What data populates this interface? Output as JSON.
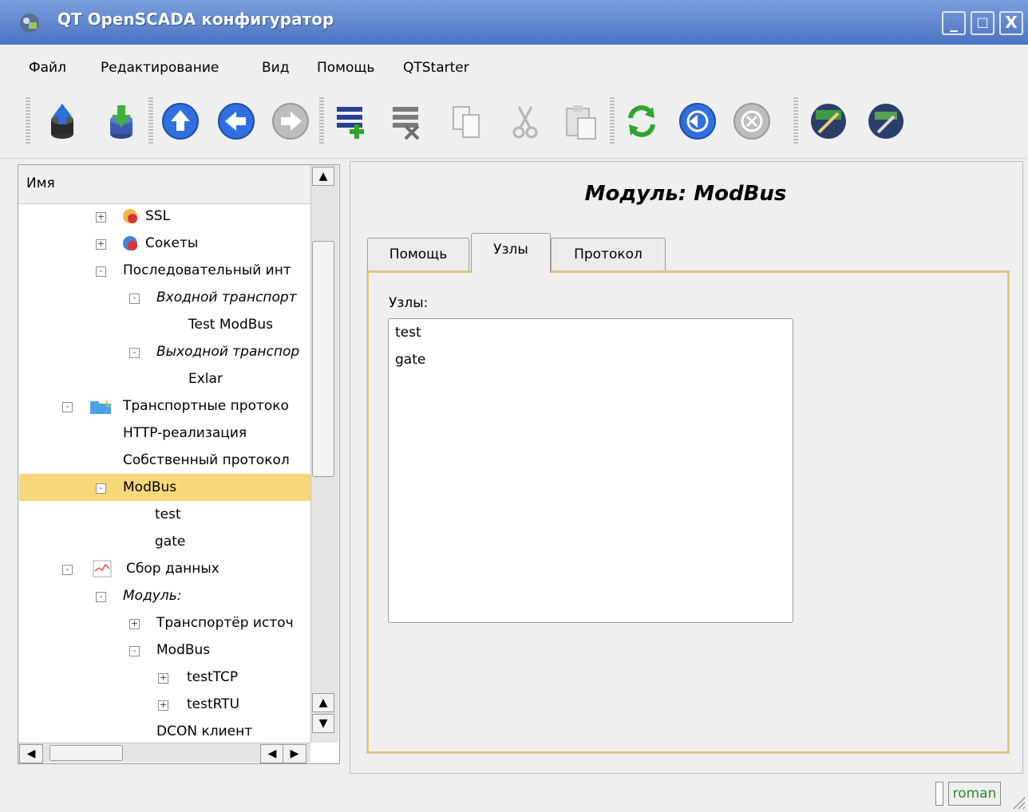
{
  "window": {
    "title": "QT OpenSCADA конфигуратор",
    "controls": {
      "minimize": "_",
      "maximize": "□",
      "close": "X"
    }
  },
  "menu": {
    "items": [
      {
        "label": "Файл"
      },
      {
        "label": "Редактирование"
      },
      {
        "label": "Вид"
      },
      {
        "label": "Помощь"
      },
      {
        "label": "QTStarter"
      }
    ]
  },
  "toolbar": {
    "buttons": [
      {
        "icon": "db-upload-icon"
      },
      {
        "icon": "db-download-icon"
      },
      {
        "icon": "arrow-up-icon"
      },
      {
        "icon": "arrow-back-icon"
      },
      {
        "icon": "arrow-forward-icon"
      },
      {
        "icon": "add-item-icon"
      },
      {
        "icon": "delete-item-icon"
      },
      {
        "icon": "copy-icon"
      },
      {
        "icon": "cut-icon"
      },
      {
        "icon": "paste-icon"
      },
      {
        "icon": "refresh-icon"
      },
      {
        "icon": "start-icon"
      },
      {
        "icon": "stop-icon"
      },
      {
        "icon": "qt-configurator-icon"
      },
      {
        "icon": "qt-starter-icon"
      }
    ]
  },
  "tree": {
    "header": "Имя",
    "rows": [
      {
        "label": "SSL",
        "expander": "+",
        "italic": false
      },
      {
        "label": "Сокеты",
        "expander": "+",
        "italic": false
      },
      {
        "label": "Последовательный инт",
        "expander": "-",
        "italic": false
      },
      {
        "label": "Входной транспорт",
        "expander": "-",
        "italic": true
      },
      {
        "label": "Test ModBus",
        "expander": "",
        "italic": false
      },
      {
        "label": "Выходной транспор",
        "expander": "-",
        "italic": true
      },
      {
        "label": "Exlar",
        "expander": "",
        "italic": false
      },
      {
        "label": "Транспортные протоко",
        "expander": "-",
        "italic": false
      },
      {
        "label": "HTTP-реализация",
        "expander": "",
        "italic": false
      },
      {
        "label": "Собственный протокол",
        "expander": "",
        "italic": false
      },
      {
        "label": "ModBus",
        "expander": "-",
        "italic": false,
        "selected": true
      },
      {
        "label": "test",
        "expander": "",
        "italic": false
      },
      {
        "label": "gate",
        "expander": "",
        "italic": false
      },
      {
        "label": "Сбор данных",
        "expander": "-",
        "italic": false
      },
      {
        "label": "Модуль:",
        "expander": "-",
        "italic": true
      },
      {
        "label": "Транспортёр источ",
        "expander": "+",
        "italic": false
      },
      {
        "label": "ModBus",
        "expander": "-",
        "italic": false
      },
      {
        "label": "testTCP",
        "expander": "+",
        "italic": false
      },
      {
        "label": "testRTU",
        "expander": "+",
        "italic": false
      },
      {
        "label": "DCON клиент",
        "expander": "",
        "italic": false
      }
    ],
    "scroll_up": "▲",
    "scroll_down": "▼",
    "scroll_left": "◀",
    "scroll_right": "▶"
  },
  "main": {
    "title": "Модуль: ModBus",
    "tabs": [
      {
        "label": "Помощь"
      },
      {
        "label": "Узлы",
        "active": true
      },
      {
        "label": "Протокол"
      }
    ],
    "nodes_label": "Узлы:",
    "nodes": [
      "test",
      "gate"
    ]
  },
  "status": {
    "user": "roman"
  },
  "colors": {
    "selection": "#f7d77a",
    "titlebar": "#5b82cc",
    "tab_border_accent": "#e9c767",
    "user_text": "#2f8a2f"
  }
}
